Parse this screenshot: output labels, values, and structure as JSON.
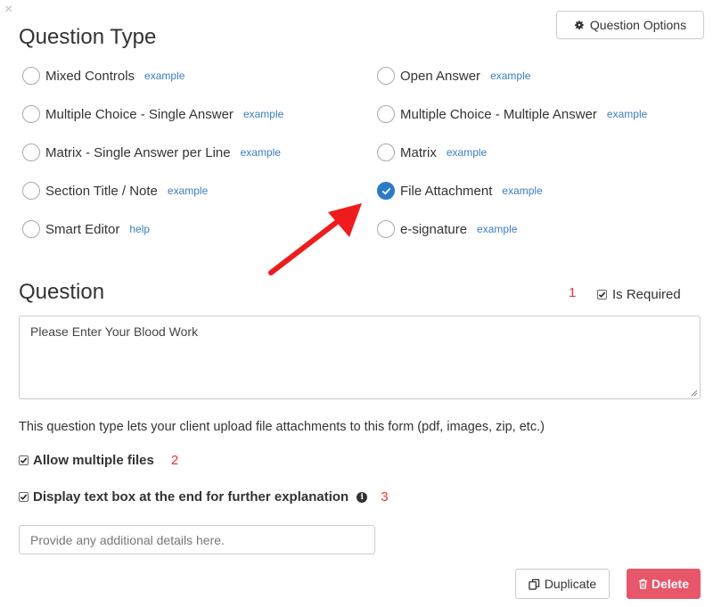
{
  "dialog": {
    "close_label": "×"
  },
  "question_type": {
    "title": "Question Type",
    "options_button": "Question Options",
    "options": [
      {
        "label": "Mixed Controls",
        "link": "example",
        "checked": false
      },
      {
        "label": "Multiple Choice - Single Answer",
        "link": "example",
        "checked": false
      },
      {
        "label": "Matrix - Single Answer per Line",
        "link": "example",
        "checked": false
      },
      {
        "label": "Section Title / Note",
        "link": "example",
        "checked": false
      },
      {
        "label": "Smart Editor",
        "link": "help",
        "checked": false
      },
      {
        "label": "Open Answer",
        "link": "example",
        "checked": false
      },
      {
        "label": "Multiple Choice - Multiple Answer",
        "link": "example",
        "checked": false
      },
      {
        "label": "Matrix",
        "link": "example",
        "checked": false
      },
      {
        "label": "File Attachment",
        "link": "example",
        "checked": true
      },
      {
        "label": "e-signature",
        "link": "example",
        "checked": false
      }
    ]
  },
  "question": {
    "title": "Question",
    "required_number": "1",
    "is_required_label": "Is Required",
    "is_required_checked": true,
    "text_value": "Please Enter Your Blood Work"
  },
  "file_attachment": {
    "description": "This question type lets your client upload file attachments to this form (pdf, images, zip, etc.)",
    "allow_multiple_label": "Allow multiple files",
    "allow_multiple_number": "2",
    "allow_multiple_checked": true,
    "display_textbox_label": "Display text box at the end for further explanation",
    "display_textbox_number": "3",
    "display_textbox_checked": true,
    "details_placeholder": "Provide any additional details here."
  },
  "actions": {
    "duplicate_label": "Duplicate",
    "delete_label": "Delete"
  },
  "colors": {
    "accent": "#2b7bc9",
    "link": "#3a7ec0",
    "annotation": "#e33333",
    "delete": "#e8566a"
  }
}
